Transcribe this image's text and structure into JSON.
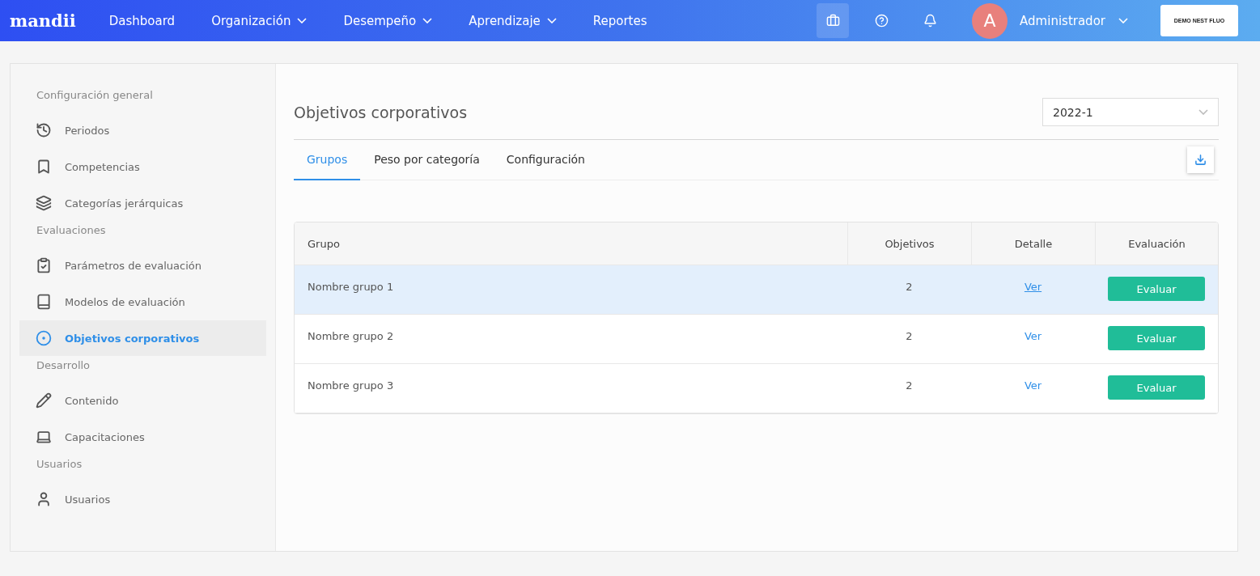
{
  "header": {
    "logo": "mandii",
    "nav": [
      {
        "label": "Dashboard",
        "has_menu": false
      },
      {
        "label": "Organización",
        "has_menu": true
      },
      {
        "label": "Desempeño",
        "has_menu": true
      },
      {
        "label": "Aprendizaje",
        "has_menu": true
      },
      {
        "label": "Reportes",
        "has_menu": false
      }
    ],
    "tools": [
      {
        "selected": true
      },
      {
        "selected": false
      },
      {
        "selected": false
      }
    ],
    "user": {
      "initial": "A",
      "name": "Administrador"
    },
    "company_button": "DEMO NEST FLUO"
  },
  "sidebar": [
    {
      "title": "Configuración general",
      "items": [
        {
          "label": "Periodos",
          "selected": false
        },
        {
          "label": "Competencias",
          "selected": false
        },
        {
          "label": "Categorías jerárquicas",
          "selected": false
        }
      ]
    },
    {
      "title": "Evaluaciones",
      "items": [
        {
          "label": "Parámetros de evaluación",
          "selected": false
        },
        {
          "label": "Modelos de evaluación",
          "selected": false
        },
        {
          "label": "Objetivos corporativos",
          "selected": true
        }
      ]
    },
    {
      "title": "Desarrollo",
      "items": [
        {
          "label": "Contenido",
          "selected": false
        },
        {
          "label": "Capacitaciones",
          "selected": false
        }
      ]
    },
    {
      "title": "Usuarios",
      "items": [
        {
          "label": "Usuarios",
          "selected": false
        }
      ]
    }
  ],
  "main": {
    "title": "Objetivos corporativos",
    "period": "2022-1",
    "tabs": [
      {
        "label": "Grupos",
        "selected": true
      },
      {
        "label": "Peso por categoría",
        "selected": false
      },
      {
        "label": "Configuración",
        "selected": false
      }
    ],
    "table": {
      "columns": [
        "Grupo",
        "Objetivos",
        "Detalle",
        "Evaluación"
      ],
      "rows": [
        {
          "group": "Nombre grupo 1",
          "objectives": "2",
          "detail": "Ver",
          "action": "Evaluar",
          "hovered": true
        },
        {
          "group": "Nombre grupo 2",
          "objectives": "2",
          "detail": "Ver",
          "action": "Evaluar",
          "hovered": false
        },
        {
          "group": "Nombre grupo 3",
          "objectives": "2",
          "detail": "Ver",
          "action": "Evaluar",
          "hovered": false
        }
      ]
    }
  }
}
